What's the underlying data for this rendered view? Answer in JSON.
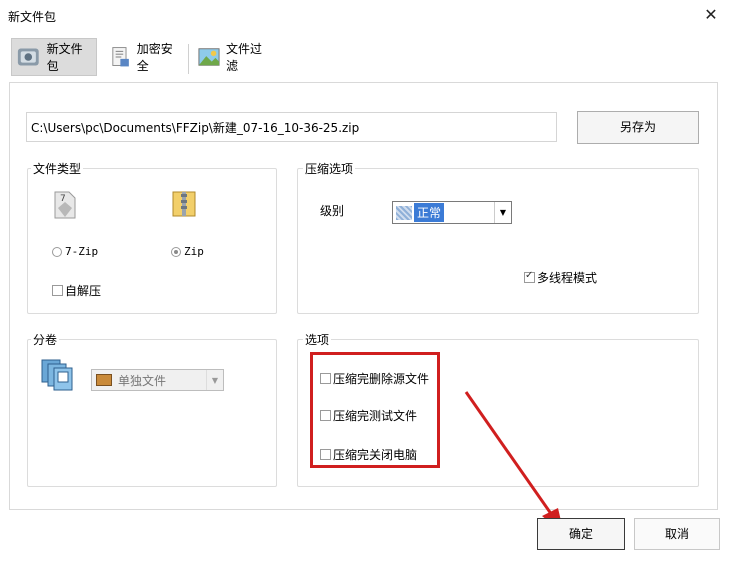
{
  "window": {
    "title": "新文件包",
    "close_glyph": "✕"
  },
  "tabs": [
    {
      "label": "新文件包",
      "icon": "new-package-icon",
      "active": true
    },
    {
      "label": "加密安全",
      "icon": "encryption-icon",
      "active": false
    },
    {
      "label": "文件过滤",
      "icon": "filter-icon",
      "active": false
    }
  ],
  "path": {
    "value": "C:\\Users\\pc\\Documents\\FFZip\\新建_07-16_10-36-25.zip"
  },
  "save_as_label": "另存为",
  "file_type": {
    "label": "文件类型",
    "options": [
      {
        "label": "7-Zip",
        "selected": false
      },
      {
        "label": "Zip",
        "selected": true
      }
    ],
    "self_extract_label": "自解压"
  },
  "compress_options": {
    "label": "压缩选项",
    "level_label": "级别",
    "level_value": "正常",
    "multithread_label": "多线程模式",
    "multithread_checked": true
  },
  "split": {
    "label": "分卷",
    "value": "单独文件"
  },
  "options": {
    "label": "选项",
    "items": [
      {
        "label": "压缩完删除源文件",
        "checked": false
      },
      {
        "label": "压缩完测试文件",
        "checked": false
      },
      {
        "label": "压缩完关闭电脑",
        "checked": false
      }
    ]
  },
  "buttons": {
    "ok": "确定",
    "cancel": "取消"
  },
  "colors": {
    "highlight": "#d01f1f",
    "selection": "#3b7bd6"
  }
}
